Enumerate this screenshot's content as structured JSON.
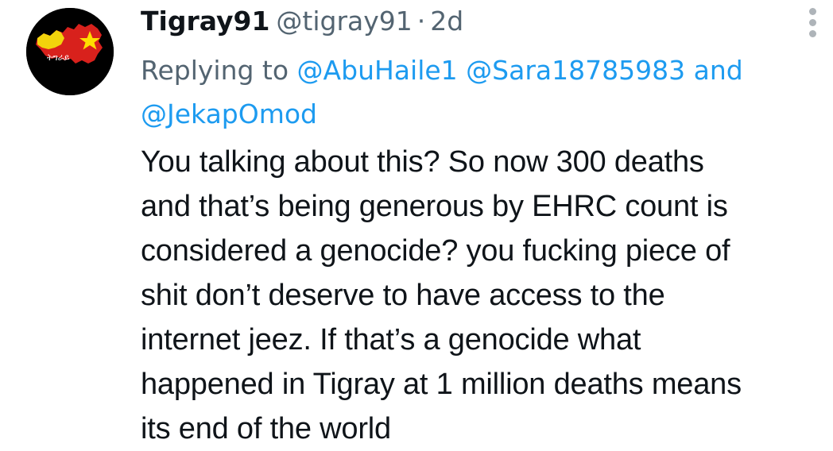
{
  "tweet": {
    "author": {
      "display_name": "Tigray91",
      "handle": "@tigray91",
      "avatar_icon": "tigray-map-flag-icon",
      "avatar_colors": {
        "background": "#000000",
        "map_red": "#d8211c",
        "map_yellow": "#f2d40c",
        "star_yellow": "#ffde00"
      }
    },
    "separator": "·",
    "timestamp": "2d",
    "reply": {
      "prefix": "Replying to",
      "mentions": [
        "@AbuHaile1",
        "@Sara18785983",
        "@JekapOmod"
      ],
      "conjunction": "and"
    },
    "text_lines": [
      "You talking about this?  So now 300 deaths",
      "and that’s being generous by EHRC  count is",
      "considered a genocide? you fucking piece of",
      "shit don’t deserve to have access to the",
      "internet jeez. If that’s a genocide what",
      "happened in Tigray at 1 million deaths means",
      "its end of the world"
    ],
    "more_icon": "vertical-ellipsis-icon"
  },
  "colors": {
    "text_primary": "#0f1419",
    "text_secondary": "#536471",
    "link": "#1d9bf0",
    "more_icon": "#aeb4b9"
  }
}
